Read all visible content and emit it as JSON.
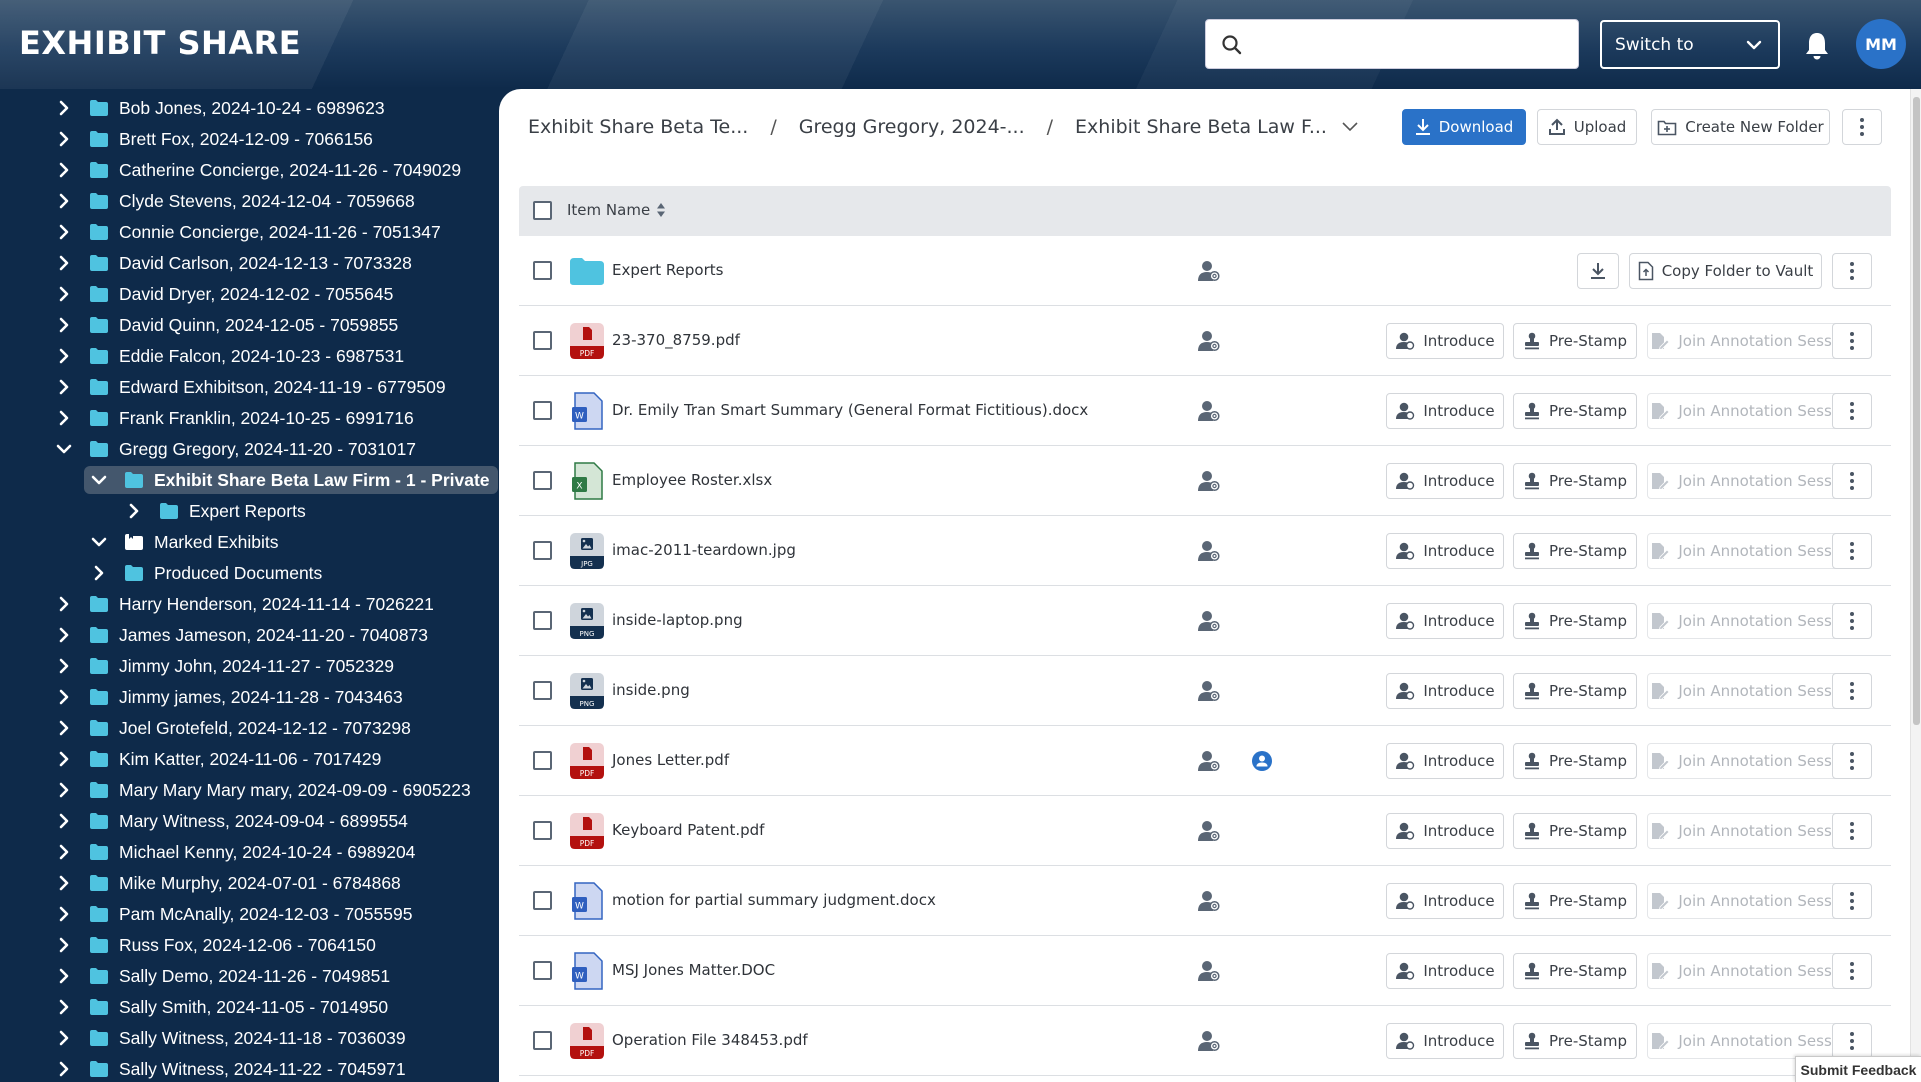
{
  "app": {
    "title": "EXHIBIT SHARE",
    "search_placeholder": "",
    "switch_label": "Switch to",
    "avatar_initials": "MM",
    "accent_color": "#2a72c8",
    "folder_color": "#4fc3e0"
  },
  "sidebar": {
    "items": [
      {
        "label": "Bob Jones, 2024-10-24 - 6989623",
        "level": 0,
        "expanded": false
      },
      {
        "label": "Brett Fox, 2024-12-09 - 7066156",
        "level": 0,
        "expanded": false
      },
      {
        "label": "Catherine Concierge, 2024-11-26 - 7049029",
        "level": 0,
        "expanded": false
      },
      {
        "label": "Clyde Stevens, 2024-12-04 - 7059668",
        "level": 0,
        "expanded": false
      },
      {
        "label": "Connie Concierge, 2024-11-26 - 7051347",
        "level": 0,
        "expanded": false
      },
      {
        "label": "David Carlson, 2024-12-13 - 7073328",
        "level": 0,
        "expanded": false
      },
      {
        "label": "David Dryer, 2024-12-02 - 7055645",
        "level": 0,
        "expanded": false
      },
      {
        "label": "David Quinn, 2024-12-05 - 7059855",
        "level": 0,
        "expanded": false
      },
      {
        "label": "Eddie Falcon, 2024-10-23 - 6987531",
        "level": 0,
        "expanded": false
      },
      {
        "label": "Edward Exhibitson, 2024-11-19 - 6779509",
        "level": 0,
        "expanded": false
      },
      {
        "label": "Frank Franklin, 2024-10-25 - 6991716",
        "level": 0,
        "expanded": false
      },
      {
        "label": "Gregg Gregory, 2024-11-20 - 7031017",
        "level": 0,
        "expanded": true
      },
      {
        "label": "Exhibit Share Beta Law Firm - 1 - Private",
        "level": 1,
        "expanded": true,
        "selected": true
      },
      {
        "label": "Expert Reports",
        "level": 2,
        "expanded": false
      },
      {
        "label": "Marked Exhibits",
        "level": 1,
        "expanded": true,
        "special": "marked"
      },
      {
        "label": "Produced Documents",
        "level": 1,
        "expanded": false
      },
      {
        "label": "Harry Henderson, 2024-11-14 - 7026221",
        "level": 0,
        "expanded": false
      },
      {
        "label": "James Jameson, 2024-11-20 - 7040873",
        "level": 0,
        "expanded": false
      },
      {
        "label": "Jimmy John, 2024-11-27 - 7052329",
        "level": 0,
        "expanded": false
      },
      {
        "label": "Jimmy james, 2024-11-28 - 7043463",
        "level": 0,
        "expanded": false
      },
      {
        "label": "Joel Grotefeld, 2024-12-12 - 7073298",
        "level": 0,
        "expanded": false
      },
      {
        "label": "Kim Katter, 2024-11-06 - 7017429",
        "level": 0,
        "expanded": false
      },
      {
        "label": "Mary Mary Mary mary, 2024-09-09 - 6905223",
        "level": 0,
        "expanded": false
      },
      {
        "label": "Mary Witness, 2024-09-04 - 6899554",
        "level": 0,
        "expanded": false
      },
      {
        "label": "Michael Kenny, 2024-10-24 - 6989204",
        "level": 0,
        "expanded": false
      },
      {
        "label": "Mike Murphy, 2024-07-01 - 6784868",
        "level": 0,
        "expanded": false
      },
      {
        "label": "Pam McAnally, 2024-12-03 - 7055595",
        "level": 0,
        "expanded": false
      },
      {
        "label": "Russ Fox, 2024-12-06 - 7064150",
        "level": 0,
        "expanded": false
      },
      {
        "label": "Sally Demo, 2024-11-26 - 7049851",
        "level": 0,
        "expanded": false
      },
      {
        "label": "Sally Smith, 2024-11-05 - 7014950",
        "level": 0,
        "expanded": false
      },
      {
        "label": "Sally Witness, 2024-11-18 - 7036039",
        "level": 0,
        "expanded": false
      },
      {
        "label": "Sally Witness, 2024-11-22 - 7045971",
        "level": 0,
        "expanded": false
      }
    ]
  },
  "breadcrumb": {
    "items": [
      "Exhibit Share Beta Te...",
      "Gregg Gregory, 2024-...",
      "Exhibit Share Beta Law F..."
    ],
    "separator": "/"
  },
  "toolbar": {
    "download_label": "Download",
    "upload_label": "Upload",
    "create_folder_label": "Create New Folder"
  },
  "table": {
    "header": {
      "item_name": "Item Name"
    },
    "row_actions": {
      "introduce": "Introduce",
      "prestamp": "Pre-Stamp",
      "join": "Join Annotation Session",
      "copy_to_vault": "Copy Folder to Vault"
    },
    "rows": [
      {
        "name": "Expert Reports",
        "type": "folder"
      },
      {
        "name": "23-370_8759.pdf",
        "type": "pdf"
      },
      {
        "name": "Dr. Emily Tran Smart Summary (General Format Fictitious).docx",
        "type": "docx"
      },
      {
        "name": "Employee Roster.xlsx",
        "type": "xlsx"
      },
      {
        "name": "imac-2011-teardown.jpg",
        "type": "jpg"
      },
      {
        "name": "inside-laptop.png",
        "type": "png"
      },
      {
        "name": "inside.png",
        "type": "png"
      },
      {
        "name": "Jones Letter.pdf",
        "type": "pdf",
        "introduced": true
      },
      {
        "name": "Keyboard Patent.pdf",
        "type": "pdf"
      },
      {
        "name": "motion for partial summary judgment.docx",
        "type": "docx"
      },
      {
        "name": "MSJ Jones Matter.DOC",
        "type": "docx"
      },
      {
        "name": "Operation File 348453.pdf",
        "type": "pdf"
      }
    ],
    "file_badges": {
      "pdf": "PDF",
      "docx": "W",
      "xlsx": "X",
      "jpg": "JPG",
      "png": "PNG"
    }
  },
  "feedback_label": "Submit Feedback"
}
